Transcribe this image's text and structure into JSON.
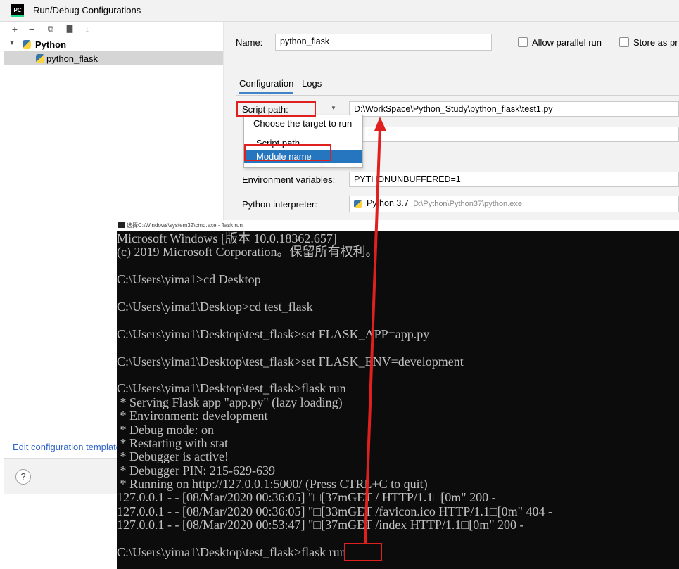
{
  "window": {
    "title": "Run/Debug Configurations",
    "app_icon_text": "PC"
  },
  "toolbar": {
    "add": "+",
    "remove": "−",
    "copy": "⧉",
    "folder": "▇",
    "sort": "↓"
  },
  "tree": {
    "group_label": "Python",
    "item_label": "python_flask"
  },
  "edit_templates_link": "Edit configuration templates...",
  "help_label": "?",
  "form": {
    "name_label": "Name:",
    "name_value": "python_flask",
    "allow_parallel_label": "Allow parallel run",
    "store_as_label": "Store as pr",
    "tabs": [
      "Configuration",
      "Logs"
    ],
    "script_path_label": "Script path:",
    "script_path_value": "D:\\WorkSpace\\Python_Study\\python_flask\\test1.py",
    "env_vars_label": "Environment variables:",
    "env_vars_value": "PYTHONUNBUFFERED=1",
    "interpreter_label": "Python interpreter:",
    "interpreter_version": "Python 3.7",
    "interpreter_path": "D:\\Python\\Python37\\python.exe"
  },
  "popup": {
    "header": "Choose the target to run",
    "options": [
      "Script path",
      "Module name"
    ],
    "selected_index": 1
  },
  "cmd": {
    "title": "选择C:\\Windows\\system32\\cmd.exe - flask  run",
    "lines": [
      "Microsoft Windows [版本 10.0.18362.657]",
      "(c) 2019 Microsoft Corporation。保留所有权利。",
      "",
      "C:\\Users\\yima1>cd Desktop",
      "",
      "C:\\Users\\yima1\\Desktop>cd test_flask",
      "",
      "C:\\Users\\yima1\\Desktop\\test_flask>set FLASK_APP=app.py",
      "",
      "C:\\Users\\yima1\\Desktop\\test_flask>set FLASK_ENV=development",
      "",
      "C:\\Users\\yima1\\Desktop\\test_flask>flask run",
      " * Serving Flask app \"app.py\" (lazy loading)",
      " * Environment: development",
      " * Debug mode: on",
      " * Restarting with stat",
      " * Debugger is active!",
      " * Debugger PIN: 215-629-639",
      " * Running on http://127.0.0.1:5000/ (Press CTRL+C to quit)",
      "127.0.0.1 - - [08/Mar/2020 00:36:05] \"□[37mGET / HTTP/1.1□[0m\" 200 -",
      "127.0.0.1 - - [08/Mar/2020 00:36:05] \"□[33mGET /favicon.ico HTTP/1.1□[0m\" 404 -",
      "127.0.0.1 - - [08/Mar/2020 00:53:47] \"□[37mGET /index HTTP/1.1□[0m\" 200 -",
      "",
      "C:\\Users\\yima1\\Desktop\\test_flask>flask run"
    ]
  },
  "colors": {
    "annotation_red": "#e0201f",
    "selection_blue": "#2675bf",
    "link_blue": "#2f65ca",
    "cmd_bg": "#0c0c0c"
  }
}
